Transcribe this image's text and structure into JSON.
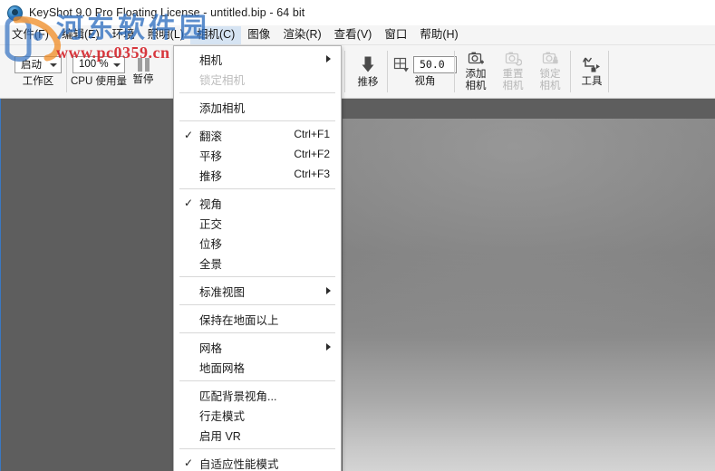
{
  "window": {
    "title": "KeyShot 9.0 Pro Floating License  - untitled.bip  - 64 bit",
    "logo_icon": "keyshot-logo-icon"
  },
  "menubar": {
    "items": [
      {
        "label": "文件(F)",
        "active": false
      },
      {
        "label": "编辑(E)",
        "active": false
      },
      {
        "label": "环境",
        "active": false
      },
      {
        "label": "照明(L)",
        "active": false
      },
      {
        "label": "相机(C)",
        "active": true
      },
      {
        "label": "图像",
        "active": false
      },
      {
        "label": "渲染(R)",
        "active": false
      },
      {
        "label": "查看(V)",
        "active": false
      },
      {
        "label": "窗口",
        "active": false
      },
      {
        "label": "帮助(H)",
        "active": false
      }
    ]
  },
  "toolbar": {
    "workspace_value": "启动",
    "workspace_label": "工作区",
    "cpu_value": "100 %",
    "cpu_label": "CPU 使用量",
    "pause_label": "暂停",
    "pause_icon": "pause-icon",
    "dolly_label": "推移",
    "dolly_icon": "dolly-arrow-icon",
    "perspective_value": "50.0",
    "perspective_label": "视角",
    "perspective_icon": "perspective-grid-icon",
    "add_camera_label_l1": "添加",
    "add_camera_label_l2": "相机",
    "add_camera_icon": "camera-add-icon",
    "reset_camera_label_l1": "重置",
    "reset_camera_label_l2": "相机",
    "reset_camera_icon": "camera-reset-icon",
    "lock_camera_label_l1": "锁定",
    "lock_camera_label_l2": "相机",
    "lock_camera_icon": "camera-lock-icon",
    "tools_label": "工具",
    "tools_icon": "tools-icon"
  },
  "dropdown": {
    "owner": "相机(C)",
    "items": [
      {
        "label": "相机",
        "checked": false,
        "disabled": false,
        "shortcut": "",
        "submenu": true
      },
      {
        "label": "锁定相机",
        "checked": false,
        "disabled": true,
        "shortcut": "",
        "submenu": false
      },
      {
        "sep": true
      },
      {
        "label": "添加相机",
        "checked": false,
        "disabled": false,
        "shortcut": "",
        "submenu": false
      },
      {
        "sep": true
      },
      {
        "label": "翻滚",
        "checked": true,
        "disabled": false,
        "shortcut": "Ctrl+F1",
        "submenu": false
      },
      {
        "label": "平移",
        "checked": false,
        "disabled": false,
        "shortcut": "Ctrl+F2",
        "submenu": false
      },
      {
        "label": "推移",
        "checked": false,
        "disabled": false,
        "shortcut": "Ctrl+F3",
        "submenu": false
      },
      {
        "sep": true
      },
      {
        "label": "视角",
        "checked": true,
        "disabled": false,
        "shortcut": "",
        "submenu": false
      },
      {
        "label": "正交",
        "checked": false,
        "disabled": false,
        "shortcut": "",
        "submenu": false
      },
      {
        "label": "位移",
        "checked": false,
        "disabled": false,
        "shortcut": "",
        "submenu": false
      },
      {
        "label": "全景",
        "checked": false,
        "disabled": false,
        "shortcut": "",
        "submenu": false
      },
      {
        "sep": true
      },
      {
        "label": "标准视图",
        "checked": false,
        "disabled": false,
        "shortcut": "",
        "submenu": true
      },
      {
        "sep": true
      },
      {
        "label": "保持在地面以上",
        "checked": false,
        "disabled": false,
        "shortcut": "",
        "submenu": false
      },
      {
        "sep": true
      },
      {
        "label": "网格",
        "checked": false,
        "disabled": false,
        "shortcut": "",
        "submenu": true
      },
      {
        "label": "地面网格",
        "checked": false,
        "disabled": false,
        "shortcut": "",
        "submenu": false
      },
      {
        "sep": true
      },
      {
        "label": "匹配背景视角...",
        "checked": false,
        "disabled": false,
        "shortcut": "",
        "submenu": false
      },
      {
        "label": "行走模式",
        "checked": false,
        "disabled": false,
        "shortcut": "",
        "submenu": false
      },
      {
        "label": "启用 VR",
        "checked": false,
        "disabled": false,
        "shortcut": "",
        "submenu": false
      },
      {
        "sep": true
      },
      {
        "label": "自适应性能模式",
        "checked": true,
        "disabled": false,
        "shortcut": "",
        "submenu": false
      }
    ]
  },
  "watermark": {
    "site_name": "河东软件园",
    "url": "www.pc0359.cn",
    "logo_icon": "watermark-logo-icon"
  },
  "colors": {
    "viewport_bg": "#5e5e5e",
    "menu_highlight": "#d6e4f3",
    "watermark_blue": "#2f6fc0",
    "watermark_red": "#d4232a"
  }
}
